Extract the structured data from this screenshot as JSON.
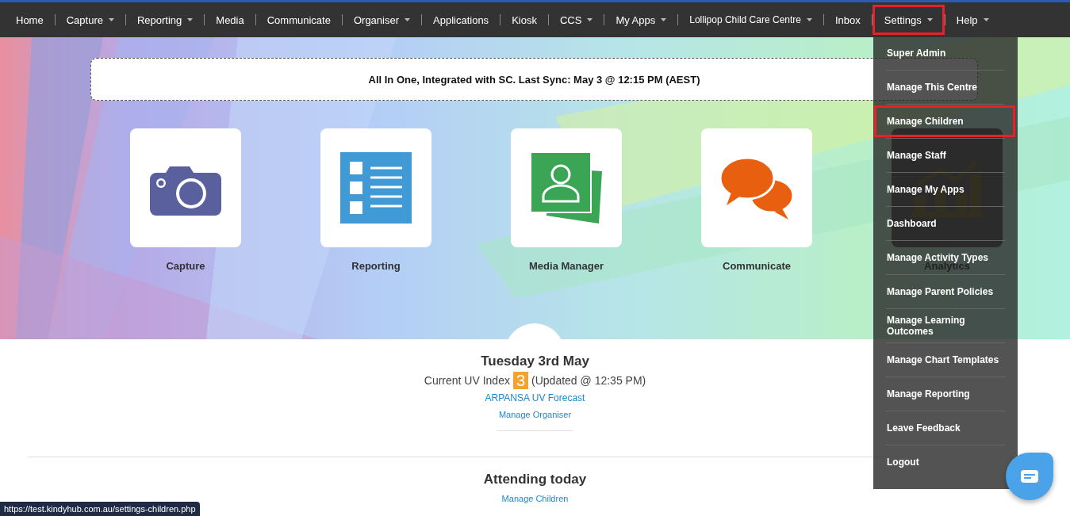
{
  "nav": [
    {
      "label": "Home",
      "dropdown": false,
      "highlighted": false
    },
    {
      "label": "Capture",
      "dropdown": true,
      "highlighted": false
    },
    {
      "label": "Reporting",
      "dropdown": true,
      "highlighted": false
    },
    {
      "label": "Media",
      "dropdown": false,
      "highlighted": false
    },
    {
      "label": "Communicate",
      "dropdown": false,
      "highlighted": false
    },
    {
      "label": "Organiser",
      "dropdown": true,
      "highlighted": false
    },
    {
      "label": "Applications",
      "dropdown": false,
      "highlighted": false
    },
    {
      "label": "Kiosk",
      "dropdown": false,
      "highlighted": false
    },
    {
      "label": "CCS",
      "dropdown": true,
      "highlighted": false
    },
    {
      "label": "My Apps",
      "dropdown": true,
      "highlighted": false
    },
    {
      "label": "Lollipop Child Care Centre",
      "dropdown": true,
      "highlighted": false
    },
    {
      "label": "Inbox",
      "dropdown": false,
      "highlighted": false
    },
    {
      "label": "Settings",
      "dropdown": true,
      "highlighted": true
    },
    {
      "label": "Help",
      "dropdown": true,
      "highlighted": false
    }
  ],
  "settings_menu": [
    {
      "label": "Super Admin",
      "highlighted": false
    },
    {
      "label": "Manage This Centre",
      "highlighted": false
    },
    {
      "label": "Manage Children",
      "highlighted": true
    },
    {
      "label": "Manage Staff",
      "highlighted": false
    },
    {
      "label": "Manage My Apps",
      "highlighted": false
    },
    {
      "label": "Dashboard",
      "highlighted": false
    },
    {
      "label": "Manage Activity Types",
      "highlighted": false
    },
    {
      "label": "Manage Parent Policies",
      "highlighted": false
    },
    {
      "label": "Manage Learning Outcomes",
      "highlighted": false
    },
    {
      "label": "Manage Chart Templates",
      "highlighted": false
    },
    {
      "label": "Manage Reporting",
      "highlighted": false
    },
    {
      "label": "Leave Feedback",
      "highlighted": false
    },
    {
      "label": "Logout",
      "highlighted": false
    }
  ],
  "banner": "All In One, Integrated with SC. Last Sync: May 3 @ 12:15 PM (AEST)",
  "tiles": [
    {
      "label": "Capture",
      "kind": "camera"
    },
    {
      "label": "Reporting",
      "kind": "list"
    },
    {
      "label": "Media Manager",
      "kind": "photos"
    },
    {
      "label": "Communicate",
      "kind": "chat"
    },
    {
      "label": "Analytics",
      "kind": "chart"
    }
  ],
  "organiser": {
    "date": "Tuesday 3rd May",
    "uv_label": "Current UV Index",
    "uv_value": "3",
    "uv_updated": "(Updated @ 12:35 PM)",
    "forecast_link": "ARPANSA UV Forecast",
    "manage_link": "Manage Organiser"
  },
  "attending": {
    "title": "Attending today",
    "manage_link": "Manage Children"
  },
  "status_url": "https://test.kindyhub.com.au/settings-children.php"
}
